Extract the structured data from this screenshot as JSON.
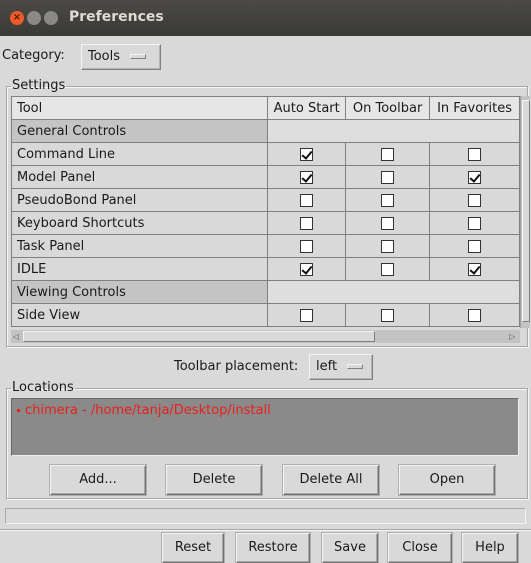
{
  "window": {
    "title": "Preferences",
    "close_glyph": "×"
  },
  "category": {
    "label": "Category:",
    "value": "Tools"
  },
  "settings": {
    "legend": "Settings",
    "columns": [
      "Tool",
      "Auto Start",
      "On Toolbar",
      "In Favorites"
    ],
    "rows": [
      {
        "type": "group",
        "name": "General Controls"
      },
      {
        "type": "tool",
        "name": "Command Line",
        "checks": [
          true,
          false,
          false
        ]
      },
      {
        "type": "tool",
        "name": "Model Panel",
        "checks": [
          true,
          false,
          true
        ]
      },
      {
        "type": "tool",
        "name": "PseudoBond Panel",
        "checks": [
          false,
          false,
          false
        ]
      },
      {
        "type": "tool",
        "name": "Keyboard Shortcuts",
        "checks": [
          false,
          false,
          false
        ]
      },
      {
        "type": "tool",
        "name": "Task Panel",
        "checks": [
          false,
          false,
          false
        ]
      },
      {
        "type": "tool",
        "name": "IDLE",
        "checks": [
          true,
          false,
          true
        ]
      },
      {
        "type": "group",
        "name": "Viewing Controls"
      },
      {
        "type": "tool",
        "name": "Side View",
        "checks": [
          false,
          false,
          false
        ]
      }
    ]
  },
  "toolbar_placement": {
    "label": "Toolbar placement:",
    "value": "left"
  },
  "locations": {
    "legend": "Locations",
    "items": [
      "chimera - /home/tanja/Desktop/install"
    ],
    "item_color": "#e8201c",
    "buttons": {
      "add": "Add...",
      "delete": "Delete",
      "delete_all": "Delete All",
      "open": "Open"
    }
  },
  "footer": {
    "reset": "Reset",
    "restore": "Restore",
    "save": "Save",
    "close": "Close",
    "help": "Help"
  },
  "icons": {
    "close": "close-icon",
    "minimize": "minimize-icon",
    "maximize": "maximize-icon",
    "checkbox": "checkbox-icon",
    "option-menu": "option-menu-indicator-icon"
  }
}
